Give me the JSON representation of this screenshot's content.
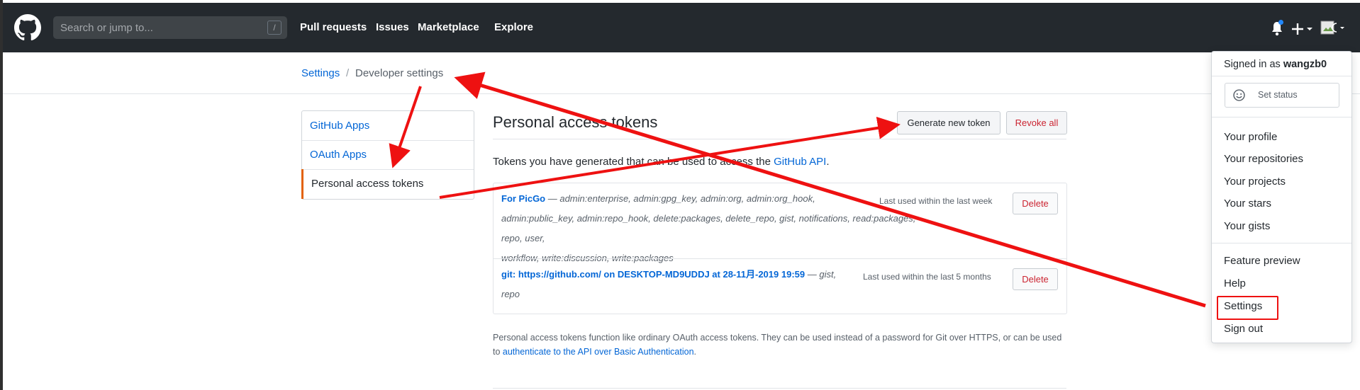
{
  "header": {
    "search_placeholder": "Search or jump to...",
    "search_shortcut": "/",
    "nav": [
      "Pull requests",
      "Issues",
      "Marketplace",
      "Explore"
    ]
  },
  "breadcrumb": {
    "settings": "Settings",
    "separator": "/",
    "current": "Developer settings"
  },
  "sidebar": {
    "items": [
      {
        "label": "GitHub Apps"
      },
      {
        "label": "OAuth Apps"
      },
      {
        "label": "Personal access tokens"
      }
    ]
  },
  "main": {
    "title": "Personal access tokens",
    "generate_button": "Generate new token",
    "revoke_button": "Revoke all",
    "description_prefix": "Tokens you have generated that can be used to access the ",
    "description_link": "GitHub API",
    "description_suffix": ".",
    "tokens": [
      {
        "name": "For PicGo",
        "scopes_line1": " — admin:enterprise, admin:gpg_key, admin:org, admin:org_hook,",
        "scopes_line2": "admin:public_key, admin:repo_hook, delete:packages, delete_repo, gist, notifications, read:packages, repo, user,",
        "scopes_line3": "workflow, write:discussion, write:packages",
        "last_used": "Last used within the last week",
        "delete": "Delete"
      },
      {
        "name": "git: https://github.com/ on DESKTOP-MD9UDDJ at 28-11月-2019 19:59",
        "scopes_line1": " — gist,",
        "scopes_line2": "repo",
        "last_used": "Last used within the last 5 months",
        "delete": "Delete"
      }
    ],
    "footer_text": "Personal access tokens function like ordinary OAuth access tokens. They can be used instead of a password for Git over HTTPS, or can be used to ",
    "footer_link": "authenticate to the API over Basic Authentication",
    "footer_suffix": "."
  },
  "dropdown": {
    "signed_in_prefix": "Signed in as ",
    "username": "wangzb0",
    "set_status": "Set status",
    "items1": [
      "Your profile",
      "Your repositories",
      "Your projects",
      "Your stars",
      "Your gists"
    ],
    "items2": [
      "Feature preview",
      "Help",
      "Settings",
      "Sign out"
    ]
  },
  "colors": {
    "header_bg": "#24292e",
    "link": "#0366d6",
    "danger": "#cb2431",
    "selected_accent": "#e36209",
    "annotation": "#ee1111"
  },
  "icons": {
    "logo": "github-mark-icon",
    "bell": "bell-icon",
    "plus": "plus-icon",
    "avatar": "avatar",
    "status": "smiley-icon"
  }
}
